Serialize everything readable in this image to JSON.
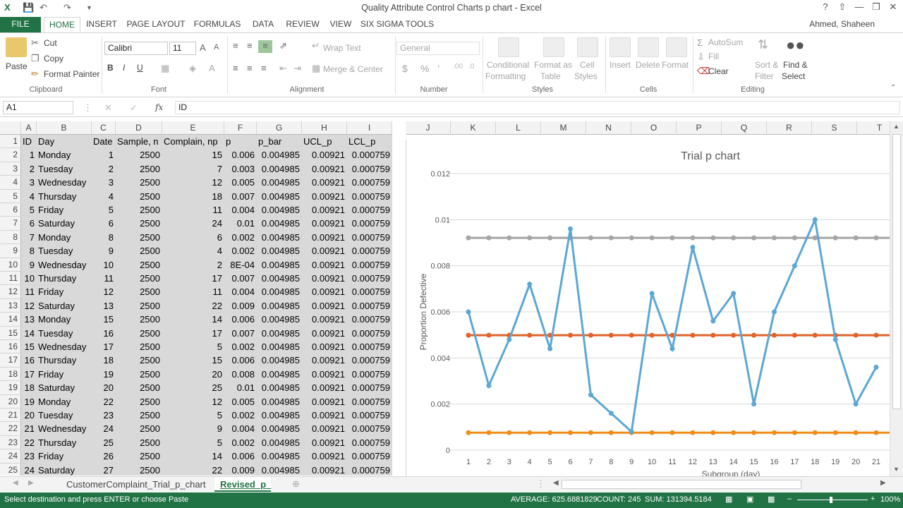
{
  "window": {
    "title": "Quality Attribute Control Charts p chart - Excel",
    "user": "Ahmed, Shaheen"
  },
  "ribbon_tabs": [
    "FILE",
    "HOME",
    "INSERT",
    "PAGE LAYOUT",
    "FORMULAS",
    "DATA",
    "REVIEW",
    "VIEW",
    "SIX SIGMA TOOLS"
  ],
  "clipboard": {
    "paste": "Paste",
    "cut": "Cut",
    "copy": "Copy",
    "format_painter": "Format Painter",
    "label": "Clipboard"
  },
  "font": {
    "name": "Calibri",
    "size": "11",
    "label": "Font",
    "bold": "B",
    "italic": "I",
    "underline": "U"
  },
  "alignment": {
    "wrap": "Wrap Text",
    "merge": "Merge & Center",
    "label": "Alignment"
  },
  "number": {
    "format": "General",
    "label": "Number",
    "currency": "$",
    "percent": "%",
    "comma": "’"
  },
  "styles": {
    "conditional": [
      "Conditional",
      "Formatting"
    ],
    "table": [
      "Format as",
      "Table"
    ],
    "cell": [
      "Cell",
      "Styles"
    ],
    "label": "Styles"
  },
  "cells": {
    "insert": "Insert",
    "delete": "Delete",
    "format": "Format",
    "label": "Cells"
  },
  "editing": {
    "autosum": "AutoSum",
    "fill": "Fill",
    "clear": "Clear",
    "sort": [
      "Sort &",
      "Filter"
    ],
    "find": [
      "Find &",
      "Select"
    ],
    "label": "Editing"
  },
  "formula_bar": {
    "name_box": "A1",
    "fx": "fx",
    "value": "ID"
  },
  "columns": [
    "A",
    "B",
    "C",
    "D",
    "E",
    "F",
    "G",
    "H",
    "I",
    "J",
    "K",
    "L",
    "M",
    "N",
    "O",
    "P",
    "Q",
    "R",
    "S",
    "T"
  ],
  "headers": [
    "ID",
    "Day",
    "Date",
    "Sample, n",
    "Complain, np",
    "p",
    "p_bar",
    "UCL_p",
    "LCL_p"
  ],
  "rows": [
    [
      "1",
      "Monday",
      "1",
      "2500",
      "15",
      "0.006",
      "0.004985",
      "0.00921",
      "0.000759"
    ],
    [
      "2",
      "Tuesday",
      "2",
      "2500",
      "7",
      "0.003",
      "0.004985",
      "0.00921",
      "0.000759"
    ],
    [
      "3",
      "Wednesday",
      "3",
      "2500",
      "12",
      "0.005",
      "0.004985",
      "0.00921",
      "0.000759"
    ],
    [
      "4",
      "Thursday",
      "4",
      "2500",
      "18",
      "0.007",
      "0.004985",
      "0.00921",
      "0.000759"
    ],
    [
      "5",
      "Friday",
      "5",
      "2500",
      "11",
      "0.004",
      "0.004985",
      "0.00921",
      "0.000759"
    ],
    [
      "6",
      "Saturday",
      "6",
      "2500",
      "24",
      "0.01",
      "0.004985",
      "0.00921",
      "0.000759"
    ],
    [
      "7",
      "Monday",
      "8",
      "2500",
      "6",
      "0.002",
      "0.004985",
      "0.00921",
      "0.000759"
    ],
    [
      "8",
      "Tuesday",
      "9",
      "2500",
      "4",
      "0.002",
      "0.004985",
      "0.00921",
      "0.000759"
    ],
    [
      "9",
      "Wednesday",
      "10",
      "2500",
      "2",
      "8E-04",
      "0.004985",
      "0.00921",
      "0.000759"
    ],
    [
      "10",
      "Thursday",
      "11",
      "2500",
      "17",
      "0.007",
      "0.004985",
      "0.00921",
      "0.000759"
    ],
    [
      "11",
      "Friday",
      "12",
      "2500",
      "11",
      "0.004",
      "0.004985",
      "0.00921",
      "0.000759"
    ],
    [
      "12",
      "Saturday",
      "13",
      "2500",
      "22",
      "0.009",
      "0.004985",
      "0.00921",
      "0.000759"
    ],
    [
      "13",
      "Monday",
      "15",
      "2500",
      "14",
      "0.006",
      "0.004985",
      "0.00921",
      "0.000759"
    ],
    [
      "14",
      "Tuesday",
      "16",
      "2500",
      "17",
      "0.007",
      "0.004985",
      "0.00921",
      "0.000759"
    ],
    [
      "15",
      "Wednesday",
      "17",
      "2500",
      "5",
      "0.002",
      "0.004985",
      "0.00921",
      "0.000759"
    ],
    [
      "16",
      "Thursday",
      "18",
      "2500",
      "15",
      "0.006",
      "0.004985",
      "0.00921",
      "0.000759"
    ],
    [
      "17",
      "Friday",
      "19",
      "2500",
      "20",
      "0.008",
      "0.004985",
      "0.00921",
      "0.000759"
    ],
    [
      "18",
      "Saturday",
      "20",
      "2500",
      "25",
      "0.01",
      "0.004985",
      "0.00921",
      "0.000759"
    ],
    [
      "19",
      "Monday",
      "22",
      "2500",
      "12",
      "0.005",
      "0.004985",
      "0.00921",
      "0.000759"
    ],
    [
      "20",
      "Tuesday",
      "23",
      "2500",
      "5",
      "0.002",
      "0.004985",
      "0.00921",
      "0.000759"
    ],
    [
      "21",
      "Wednesday",
      "24",
      "2500",
      "9",
      "0.004",
      "0.004985",
      "0.00921",
      "0.000759"
    ],
    [
      "22",
      "Thursday",
      "25",
      "2500",
      "5",
      "0.002",
      "0.004985",
      "0.00921",
      "0.000759"
    ],
    [
      "23",
      "Friday",
      "26",
      "2500",
      "14",
      "0.006",
      "0.004985",
      "0.00921",
      "0.000759"
    ],
    [
      "24",
      "Saturday",
      "27",
      "2500",
      "22",
      "0.009",
      "0.004985",
      "0.00921",
      "0.000759"
    ]
  ],
  "chart_data": {
    "type": "line",
    "title": "Trial p chart",
    "ylabel": "Proportion Defective",
    "xlabel": "Subgroup (day)",
    "ylim": [
      0,
      0.012
    ],
    "yticks": [
      "0",
      "0.002",
      "0.004",
      "0.006",
      "0.008",
      "0.01",
      "0.012"
    ],
    "categories": [
      "1",
      "2",
      "3",
      "4",
      "5",
      "6",
      "7",
      "8",
      "9",
      "10",
      "11",
      "12",
      "13",
      "14",
      "15",
      "16",
      "17",
      "18",
      "19",
      "20",
      "21"
    ],
    "series": [
      {
        "values": [
          0.006,
          0.0028,
          0.0048,
          0.0072,
          0.0044,
          0.0096,
          0.0024,
          0.0016,
          0.0008,
          0.0068,
          0.0044,
          0.0088,
          0.0056,
          0.0068,
          0.002,
          0.006,
          0.008,
          0.01,
          0.0048,
          0.002,
          0.0036
        ],
        "color": "#5ba7d6"
      },
      {
        "values": [
          0.00921,
          0.00921,
          0.00921,
          0.00921,
          0.00921,
          0.00921,
          0.00921,
          0.00921,
          0.00921,
          0.00921,
          0.00921,
          0.00921,
          0.00921,
          0.00921,
          0.00921,
          0.00921,
          0.00921,
          0.00921,
          0.00921,
          0.00921,
          0.00921
        ],
        "color": "#a5a5a5"
      },
      {
        "values": [
          0.004985,
          0.004985,
          0.004985,
          0.004985,
          0.004985,
          0.004985,
          0.004985,
          0.004985,
          0.004985,
          0.004985,
          0.004985,
          0.004985,
          0.004985,
          0.004985,
          0.004985,
          0.004985,
          0.004985,
          0.004985,
          0.004985,
          0.004985,
          0.004985
        ],
        "color": "#e0632a"
      },
      {
        "values": [
          0.000759,
          0.000759,
          0.000759,
          0.000759,
          0.000759,
          0.000759,
          0.000759,
          0.000759,
          0.000759,
          0.000759,
          0.000759,
          0.000759,
          0.000759,
          0.000759,
          0.000759,
          0.000759,
          0.000759,
          0.000759,
          0.000759,
          0.000759,
          0.000759
        ],
        "color": "#f08c1a"
      }
    ]
  },
  "sheet_tabs": [
    "CustomerComplaint_Trial_p_chart",
    "Revised_p_"
  ],
  "status": {
    "message": "Select destination and press ENTER or choose Paste",
    "average": "AVERAGE: 625.6881829",
    "count": "COUNT: 245",
    "sum": "SUM: 131394.5184",
    "zoom": "100%"
  },
  "colors": {
    "excel_green": "#217346"
  }
}
